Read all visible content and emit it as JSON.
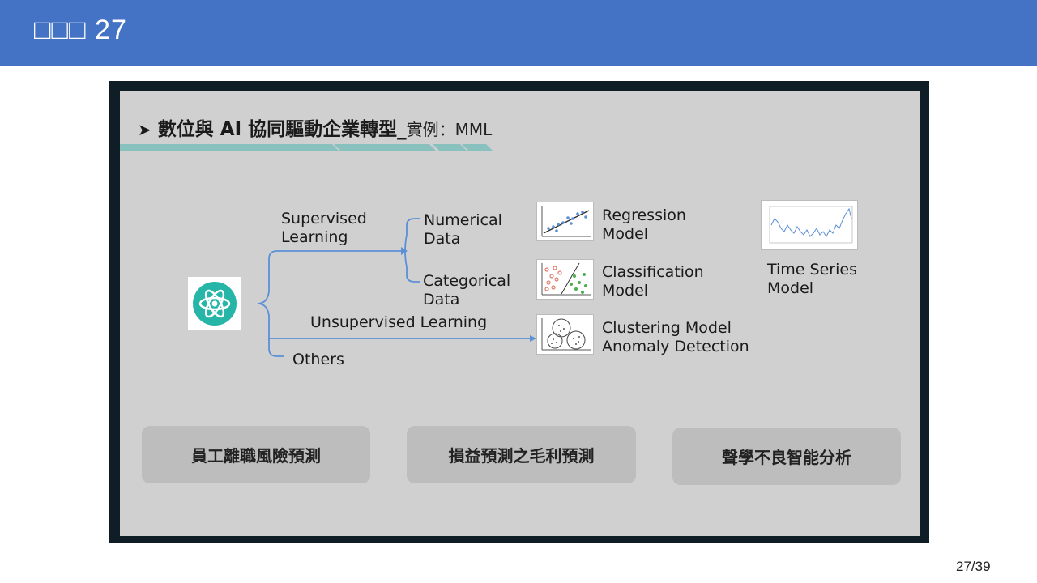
{
  "header": {
    "title": "□□□ 27"
  },
  "slide": {
    "heading_main": "數位與 AI 協同驅動企業轉型_",
    "heading_sub": "實例：MML",
    "supervised_line1": "Supervised",
    "supervised_line2": "Learning",
    "numerical_line1": "Numerical",
    "numerical_line2": "Data",
    "categorical_line1": "Categorical",
    "categorical_line2": "Data",
    "unsupervised": "Unsupervised Learning",
    "others": "Others",
    "regression_line1": "Regression",
    "regression_line2": "Model",
    "classification_line1": "Classification",
    "classification_line2": "Model",
    "clustering_line1": "Clustering Model",
    "clustering_line2": "Anomaly Detection",
    "timeseries_line1": "Time Series",
    "timeseries_line2": "Model"
  },
  "buttons": {
    "b1": "員工離職風險預測",
    "b2": "損益預測之毛利預測",
    "b3": "聲學不良智能分析"
  },
  "footer": {
    "page": "27/39"
  },
  "colors": {
    "header": "#4472c4",
    "accent_teal": "#88c1bd",
    "connector": "#5b8fd6",
    "atom": "#26b5a7"
  }
}
